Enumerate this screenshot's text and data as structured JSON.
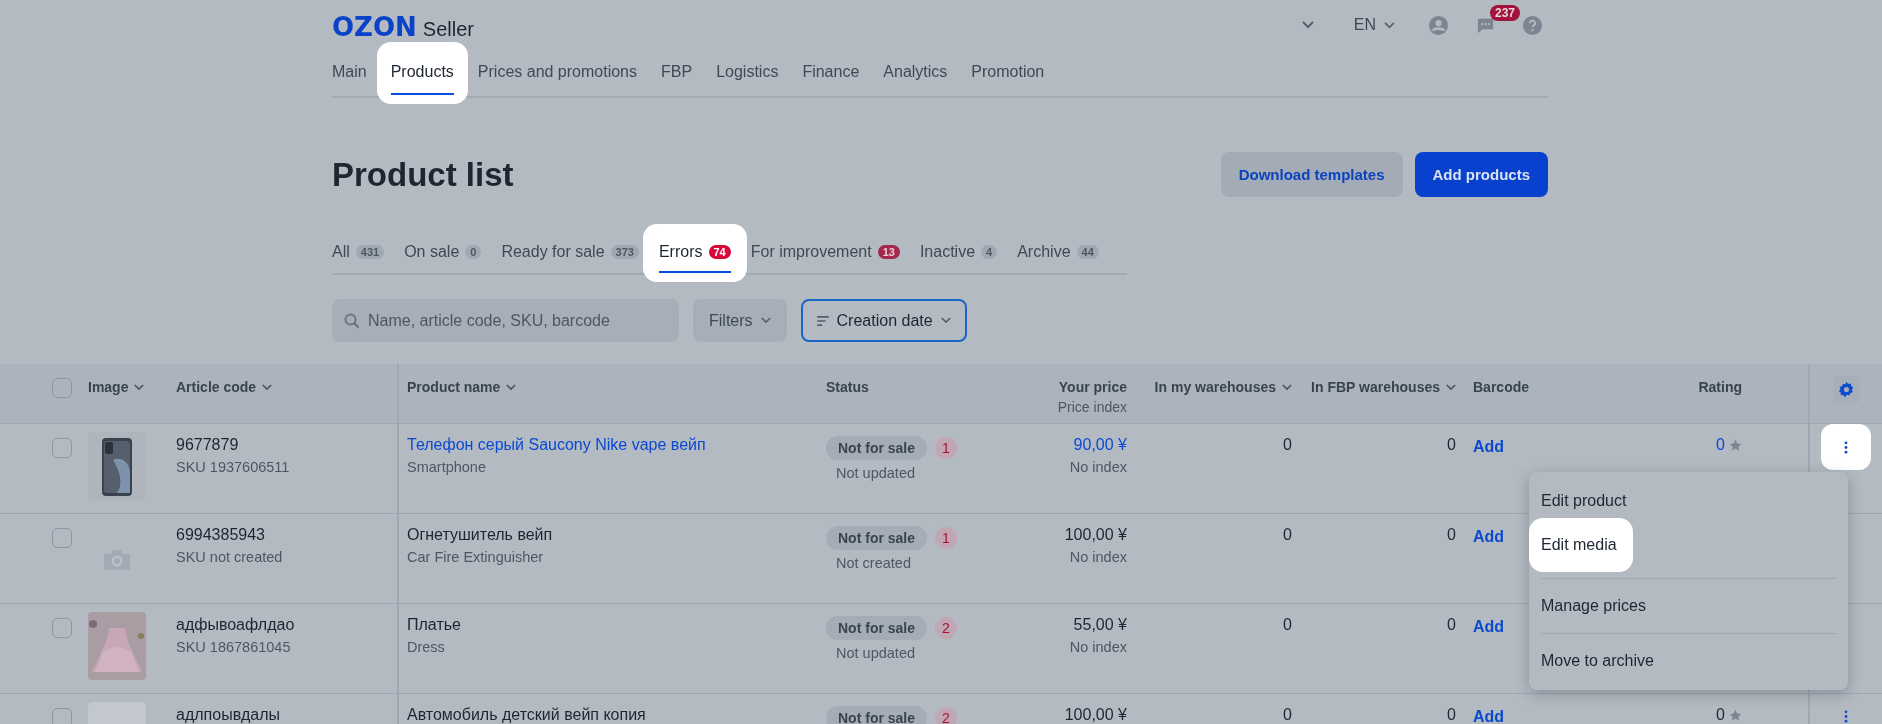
{
  "header": {
    "logo": "OZON",
    "logo_suffix": "Seller",
    "language": "EN",
    "messages_count": "237"
  },
  "nav": [
    {
      "label": "Main",
      "selected": false,
      "highlighted": false
    },
    {
      "label": "Products",
      "selected": true,
      "highlighted": true
    },
    {
      "label": "Prices and promotions",
      "selected": false,
      "highlighted": false
    },
    {
      "label": "FBP",
      "selected": false,
      "highlighted": false
    },
    {
      "label": "Logistics",
      "selected": false,
      "highlighted": false
    },
    {
      "label": "Finance",
      "selected": false,
      "highlighted": false
    },
    {
      "label": "Analytics",
      "selected": false,
      "highlighted": false
    },
    {
      "label": "Promotion",
      "selected": false,
      "highlighted": false
    }
  ],
  "page_title": "Product list",
  "actions": [
    {
      "label": "Download templates",
      "kind": "secondary"
    },
    {
      "label": "Add products",
      "kind": "primary"
    }
  ],
  "tabs": [
    {
      "label": "All",
      "count": "431",
      "kind": "neutral",
      "selected": false,
      "highlighted": false
    },
    {
      "label": "On sale",
      "count": "0",
      "kind": "neutral",
      "selected": false,
      "highlighted": false
    },
    {
      "label": "Ready for sale",
      "count": "373",
      "kind": "neutral",
      "selected": false,
      "highlighted": false
    },
    {
      "label": "Errors",
      "count": "74",
      "kind": "error",
      "selected": true,
      "highlighted": true
    },
    {
      "label": "For improvement",
      "count": "13",
      "kind": "warning",
      "selected": false,
      "highlighted": false
    },
    {
      "label": "Inactive",
      "count": "4",
      "kind": "neutral",
      "selected": false,
      "highlighted": false
    },
    {
      "label": "Archive",
      "count": "44",
      "kind": "neutral",
      "selected": false,
      "highlighted": false
    }
  ],
  "search": {
    "placeholder": "Name, article code, SKU, barcode"
  },
  "filters_button": "Filters",
  "sort_button": "Creation date",
  "table": {
    "all_checked": false,
    "columns": [
      {
        "label": "Image",
        "sortable": true
      },
      {
        "label": "Article code",
        "sortable": true
      },
      {
        "label": "Product name",
        "sortable": true
      },
      {
        "label": "Status",
        "sortable": false
      },
      {
        "label": "Your price",
        "sub": "Price index",
        "sortable": false
      },
      {
        "label": "In my warehouses",
        "sortable": true
      },
      {
        "label": "In FBP warehouses",
        "sortable": true
      },
      {
        "label": "Barcode",
        "sortable": false
      },
      {
        "label": "Rating",
        "sortable": false
      }
    ],
    "rows": [
      {
        "checked": false,
        "article": "9677879",
        "sku": "SKU 1937606511",
        "name": "Телефон серый Saucony Nike vape вейп",
        "name_link": true,
        "category": "Smartphone",
        "status": "Not for sale",
        "errors": "1",
        "status_note": "Not updated",
        "price": "90,00 ¥",
        "price_link": true,
        "price_index": "No index",
        "my_warehouses": "0",
        "fbp_warehouses": "0",
        "barcode": "Add",
        "rating": "0",
        "rating_link": true,
        "menu_button": true,
        "menu_button_highlighted": true
      },
      {
        "checked": false,
        "image": {
          "kind": "placeholder"
        },
        "article": "6994385943",
        "sku": "SKU not created",
        "name": "Огнетушитель вейп",
        "name_link": false,
        "category": "Car Fire Extinguisher",
        "status": "Not for sale",
        "errors": "1",
        "status_note": "Not created",
        "price": "100,00 ¥",
        "price_link": false,
        "price_index": "No index",
        "my_warehouses": "0",
        "fbp_warehouses": "0",
        "barcode": "Add"
      },
      {
        "checked": false,
        "article": "адфывоафлдао",
        "sku": "SKU 1867861045",
        "name": "Платье",
        "name_link": false,
        "category": "Dress",
        "status": "Not for sale",
        "errors": "2",
        "status_note": "Not updated",
        "price": "55,00 ¥",
        "price_link": false,
        "price_index": "No index",
        "my_warehouses": "0",
        "fbp_warehouses": "0",
        "barcode": "Add"
      },
      {
        "checked": false,
        "article": "адлпоывдалы",
        "name": "Автомобиль детский вейп копия",
        "name_link": false,
        "status": "Not for sale",
        "errors": "2",
        "price": "100,00 ¥",
        "price_link": false,
        "my_warehouses": "0",
        "fbp_warehouses": "0",
        "barcode": "Add",
        "rating": "0",
        "rating_link": false,
        "menu_button": true,
        "menu_button_highlighted": false
      }
    ]
  },
  "row_menu": {
    "items": [
      {
        "label": "Edit product",
        "separated": false,
        "highlighted": false
      },
      {
        "label": "Edit media",
        "separated": false,
        "highlighted": true
      },
      {
        "label": "Manage prices",
        "separated": true,
        "highlighted": false
      },
      {
        "label": "Move to archive",
        "separated": true,
        "highlighted": false
      }
    ]
  }
}
